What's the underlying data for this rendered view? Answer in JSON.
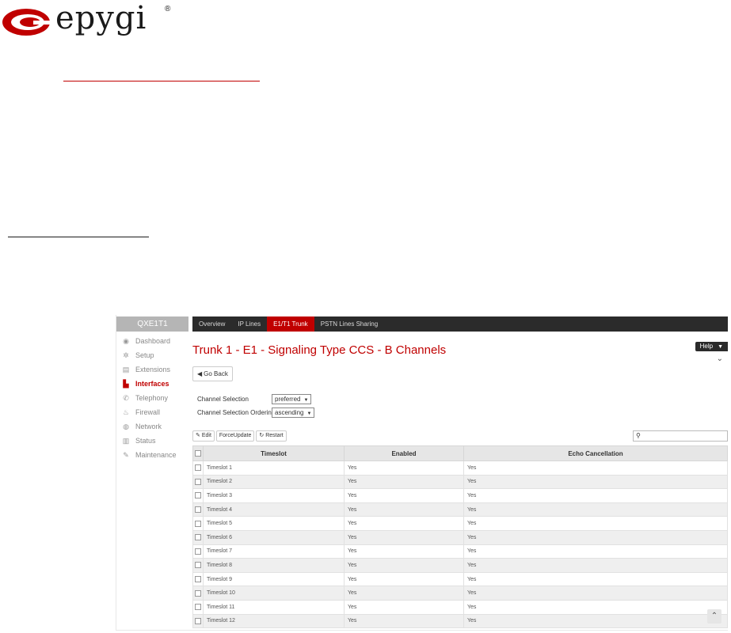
{
  "brand": {
    "name": "epygi",
    "registered": "®",
    "accent": "#c00000"
  },
  "device_name": "QXE1T1",
  "tabs": [
    {
      "label": "Overview",
      "active": false
    },
    {
      "label": "IP Lines",
      "active": false
    },
    {
      "label": "E1/T1 Trunk",
      "active": true
    },
    {
      "label": "PSTN Lines Sharing",
      "active": false
    }
  ],
  "sidebar": {
    "items": [
      {
        "label": "Dashboard",
        "icon": "dashboard-icon",
        "active": false
      },
      {
        "label": "Setup",
        "icon": "gear-icon",
        "active": false
      },
      {
        "label": "Extensions",
        "icon": "book-icon",
        "active": false
      },
      {
        "label": "Interfaces",
        "icon": "interfaces-icon",
        "active": true
      },
      {
        "label": "Telephony",
        "icon": "phone-icon",
        "active": false
      },
      {
        "label": "Firewall",
        "icon": "fire-icon",
        "active": false
      },
      {
        "label": "Network",
        "icon": "globe-icon",
        "active": false
      },
      {
        "label": "Status",
        "icon": "chart-icon",
        "active": false
      },
      {
        "label": "Maintenance",
        "icon": "wrench-icon",
        "active": false
      }
    ]
  },
  "page": {
    "title": "Trunk 1 - E1 - Signaling Type CCS - B Channels",
    "help_label": "Help",
    "go_back_label": "Go Back"
  },
  "form": {
    "channel_selection_label": "Channel Selection",
    "channel_selection_value": "preferred",
    "channel_selection_ordering_label": "Channel Selection Ordering",
    "channel_selection_ordering_value": "ascending"
  },
  "toolbar": {
    "edit_label": "Edit",
    "force_update_label": "ForceUpdate",
    "restart_label": "Restart",
    "search_placeholder": ""
  },
  "table": {
    "columns": [
      "Timeslot",
      "Enabled",
      "Echo Cancellation"
    ],
    "rows": [
      [
        "Timeslot 1",
        "Yes",
        "Yes"
      ],
      [
        "Timeslot 2",
        "Yes",
        "Yes"
      ],
      [
        "Timeslot 3",
        "Yes",
        "Yes"
      ],
      [
        "Timeslot 4",
        "Yes",
        "Yes"
      ],
      [
        "Timeslot 5",
        "Yes",
        "Yes"
      ],
      [
        "Timeslot 6",
        "Yes",
        "Yes"
      ],
      [
        "Timeslot 7",
        "Yes",
        "Yes"
      ],
      [
        "Timeslot 8",
        "Yes",
        "Yes"
      ],
      [
        "Timeslot 9",
        "Yes",
        "Yes"
      ],
      [
        "Timeslot 10",
        "Yes",
        "Yes"
      ],
      [
        "Timeslot 11",
        "Yes",
        "Yes"
      ],
      [
        "Timeslot 12",
        "Yes",
        "Yes"
      ]
    ]
  }
}
